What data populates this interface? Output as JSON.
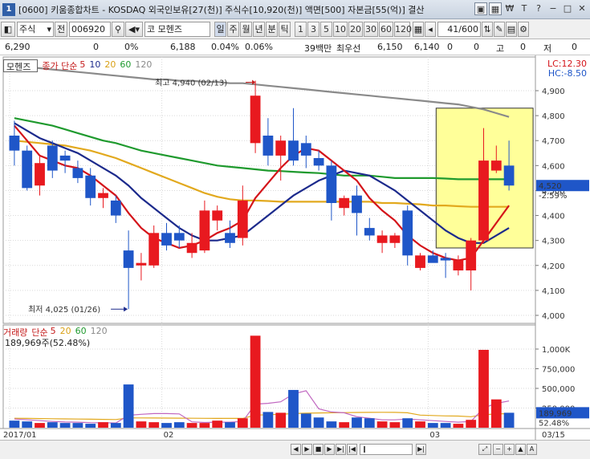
{
  "window": {
    "app_number": "1",
    "title": "[0600] 키움종합차트 - KOSDAQ 외국인보유[27(천)] 주식수[10,920(천)] 액면[500] 자본금[55(억)] 결산"
  },
  "toolbar": {
    "market": "주식",
    "prev": "전",
    "code": "006920",
    "stock_prefix": "코",
    "stock_name": "모헨즈",
    "periods": [
      "일",
      "주",
      "월",
      "년",
      "분",
      "틱"
    ],
    "intervals": [
      "1",
      "3",
      "5",
      "10",
      "20",
      "30",
      "60",
      "120"
    ],
    "page_counter": "41/600"
  },
  "infobar": {
    "price": "6,290",
    "change": "0",
    "pct": "0%",
    "open": "6,188",
    "r1": "0.04%",
    "r2": "0.06%",
    "amount": "39백만",
    "best_label": "최우선",
    "ask": "6,150",
    "bid": "6,140",
    "v1": "0",
    "v2": "0",
    "v3": "고",
    "v4": "0",
    "v5": "저",
    "v6": "0"
  },
  "price_legend": {
    "name": "모헨즈",
    "type": "종가 단순",
    "ma": [
      "5",
      "10",
      "20",
      "60",
      "120"
    ],
    "lc": "LC:12.30",
    "hc": "HC:-8.50"
  },
  "volume_legend": {
    "name": "거래량",
    "type": "단순",
    "ma": [
      "5",
      "20",
      "60",
      "120"
    ],
    "info": "189,969주(52.48%)"
  },
  "annotations": {
    "high": "최고 4,940 (02/13)",
    "low": "최저 4,025 (01/26)"
  },
  "current": {
    "price_label": "4,520",
    "pct_label": "-2.59%",
    "vol_label": "189,969",
    "vol_pct_label": "52.48%"
  },
  "colors": {
    "up": "#e8191f",
    "down": "#1f56c8",
    "ma5": "#d4141a",
    "ma10": "#1c2a8c",
    "ma20": "#e2a91e",
    "ma60": "#1f9a2e",
    "ma120": "#8a8a8a",
    "highlight": "#ffff99"
  },
  "chart_data": [
    {
      "type": "candlestick",
      "title": "모헨즈",
      "y_ticks": [
        4000,
        4100,
        4200,
        4300,
        4400,
        4500,
        4600,
        4700,
        4800,
        4900
      ],
      "ylim": [
        3970,
        5030
      ],
      "x_labels": [
        "2017/01",
        "02",
        "03",
        "03/15"
      ],
      "candles": [
        {
          "o": 4720,
          "h": 4780,
          "l": 4600,
          "c": 4660
        },
        {
          "o": 4660,
          "h": 4680,
          "l": 4500,
          "c": 4510
        },
        {
          "o": 4520,
          "h": 4640,
          "l": 4480,
          "c": 4610
        },
        {
          "o": 4680,
          "h": 4700,
          "l": 4550,
          "c": 4580
        },
        {
          "o": 4640,
          "h": 4660,
          "l": 4570,
          "c": 4620
        },
        {
          "o": 4590,
          "h": 4620,
          "l": 4530,
          "c": 4550
        },
        {
          "o": 4560,
          "h": 4590,
          "l": 4440,
          "c": 4470
        },
        {
          "o": 4470,
          "h": 4510,
          "l": 4430,
          "c": 4490
        },
        {
          "o": 4460,
          "h": 4480,
          "l": 4370,
          "c": 4400
        },
        {
          "o": 4260,
          "h": 4340,
          "l": 4025,
          "c": 4190
        },
        {
          "o": 4200,
          "h": 4250,
          "l": 4140,
          "c": 4210
        },
        {
          "o": 4200,
          "h": 4360,
          "l": 4190,
          "c": 4330
        },
        {
          "o": 4330,
          "h": 4370,
          "l": 4260,
          "c": 4280
        },
        {
          "o": 4330,
          "h": 4360,
          "l": 4270,
          "c": 4300
        },
        {
          "o": 4250,
          "h": 4330,
          "l": 4230,
          "c": 4290
        },
        {
          "o": 4260,
          "h": 4460,
          "l": 4250,
          "c": 4420
        },
        {
          "o": 4380,
          "h": 4440,
          "l": 4340,
          "c": 4420
        },
        {
          "o": 4330,
          "h": 4380,
          "l": 4270,
          "c": 4290
        },
        {
          "o": 4310,
          "h": 4520,
          "l": 4280,
          "c": 4460
        },
        {
          "o": 4690,
          "h": 4940,
          "l": 4650,
          "c": 4880
        },
        {
          "o": 4720,
          "h": 4790,
          "l": 4600,
          "c": 4640
        },
        {
          "o": 4640,
          "h": 4720,
          "l": 4540,
          "c": 4700
        },
        {
          "o": 4700,
          "h": 4830,
          "l": 4600,
          "c": 4620
        },
        {
          "o": 4690,
          "h": 4720,
          "l": 4590,
          "c": 4640
        },
        {
          "o": 4630,
          "h": 4660,
          "l": 4580,
          "c": 4600
        },
        {
          "o": 4600,
          "h": 4620,
          "l": 4380,
          "c": 4450
        },
        {
          "o": 4430,
          "h": 4480,
          "l": 4400,
          "c": 4470
        },
        {
          "o": 4480,
          "h": 4520,
          "l": 4320,
          "c": 4410
        },
        {
          "o": 4350,
          "h": 4390,
          "l": 4300,
          "c": 4320
        },
        {
          "o": 4290,
          "h": 4340,
          "l": 4250,
          "c": 4320
        },
        {
          "o": 4290,
          "h": 4330,
          "l": 4270,
          "c": 4320
        },
        {
          "o": 4420,
          "h": 4440,
          "l": 4200,
          "c": 4240
        },
        {
          "o": 4190,
          "h": 4250,
          "l": 4180,
          "c": 4240
        },
        {
          "o": 4240,
          "h": 4260,
          "l": 4220,
          "c": 4210
        },
        {
          "o": 4230,
          "h": 4250,
          "l": 4150,
          "c": 4220
        },
        {
          "o": 4180,
          "h": 4240,
          "l": 4160,
          "c": 4220
        },
        {
          "o": 4180,
          "h": 4310,
          "l": 4100,
          "c": 4300
        },
        {
          "o": 4300,
          "h": 4750,
          "l": 4290,
          "c": 4620
        },
        {
          "o": 4580,
          "h": 4680,
          "l": 4570,
          "c": 4620
        },
        {
          "o": 4600,
          "h": 4700,
          "l": 4500,
          "c": 4520
        }
      ],
      "moving_averages": [
        {
          "name": "5",
          "values": [
            4760,
            4700,
            4640,
            4620,
            4600,
            4590,
            4560,
            4520,
            4480,
            4410,
            4350,
            4310,
            4290,
            4270,
            4280,
            4300,
            4330,
            4350,
            4380,
            4470,
            4530,
            4590,
            4640,
            4670,
            4660,
            4620,
            4580,
            4540,
            4470,
            4420,
            4380,
            4320,
            4280,
            4250,
            4230,
            4220,
            4230,
            4300,
            4370,
            4440
          ]
        },
        {
          "name": "10",
          "values": [
            4770,
            4740,
            4710,
            4690,
            4670,
            4650,
            4620,
            4590,
            4560,
            4520,
            4470,
            4430,
            4390,
            4350,
            4320,
            4300,
            4300,
            4310,
            4320,
            4360,
            4400,
            4440,
            4480,
            4510,
            4540,
            4560,
            4580,
            4570,
            4560,
            4530,
            4500,
            4460,
            4420,
            4380,
            4340,
            4310,
            4290,
            4290,
            4320,
            4350
          ]
        },
        {
          "name": "20",
          "values": [
            4700,
            4695,
            4690,
            4685,
            4680,
            4670,
            4660,
            4645,
            4630,
            4610,
            4590,
            4570,
            4550,
            4530,
            4510,
            4490,
            4475,
            4465,
            4460,
            4460,
            4458,
            4455,
            4455,
            4455,
            4455,
            4455,
            4455,
            4455,
            4455,
            4450,
            4450,
            4447,
            4445,
            4440,
            4440,
            4437,
            4435,
            4435,
            4435,
            4435
          ]
        },
        {
          "name": "60",
          "values": [
            4790,
            4780,
            4770,
            4760,
            4745,
            4730,
            4715,
            4700,
            4690,
            4675,
            4660,
            4650,
            4640,
            4630,
            4620,
            4610,
            4600,
            4595,
            4590,
            4585,
            4580,
            4578,
            4575,
            4572,
            4570,
            4565,
            4560,
            4560,
            4560,
            4555,
            4550,
            4550,
            4550,
            4550,
            4548,
            4545,
            4545,
            4545,
            4545,
            4545
          ]
        },
        {
          "name": "120",
          "values": [
            5000,
            4995,
            4990,
            4985,
            4980,
            4975,
            4970,
            4965,
            4960,
            4955,
            4950,
            4945,
            4945,
            4940,
            4940,
            4935,
            4935,
            4930,
            4930,
            4925,
            4920,
            4915,
            4910,
            4905,
            4900,
            4895,
            4890,
            4885,
            4880,
            4875,
            4870,
            4865,
            4860,
            4855,
            4850,
            4845,
            4835,
            4825,
            4810,
            4795
          ]
        }
      ],
      "annotations": [
        "최고 4,940 (02/13)",
        "최저 4,025 (01/26)"
      ],
      "current_price": 4520,
      "grid": true
    },
    {
      "type": "bar",
      "title": "거래량",
      "y_ticks": [
        250000,
        500000,
        750000,
        1000000
      ],
      "y_tick_labels": [
        "250,000",
        "500,000",
        "750,000",
        "1,000K"
      ],
      "ylim": [
        0,
        1150000
      ],
      "volumes": [
        90000,
        80000,
        60000,
        70000,
        60000,
        60000,
        50000,
        70000,
        60000,
        550000,
        80000,
        70000,
        60000,
        70000,
        60000,
        60000,
        90000,
        70000,
        120000,
        1170000,
        200000,
        190000,
        480000,
        180000,
        130000,
        80000,
        70000,
        130000,
        120000,
        80000,
        70000,
        120000,
        80000,
        60000,
        60000,
        50000,
        100000,
        990000,
        360000,
        190000
      ],
      "volume_ma5": [
        110000,
        100000,
        90000,
        80000,
        72000,
        70000,
        64000,
        62000,
        60000,
        158000,
        170000,
        180000,
        180000,
        176000,
        74000,
        66000,
        70000,
        70000,
        80000,
        300000,
        310000,
        330000,
        430000,
        470000,
        240000,
        200000,
        190000,
        140000,
        120000,
        100000,
        100000,
        110000,
        100000,
        90000,
        80000,
        70000,
        80000,
        250000,
        310000,
        340000
      ],
      "volume_ma20": [
        120000,
        118000,
        116000,
        114000,
        112000,
        110000,
        108000,
        106000,
        104000,
        125000,
        124000,
        123000,
        122000,
        121000,
        120000,
        119000,
        118000,
        118000,
        118000,
        160000,
        165000,
        170000,
        180000,
        185000,
        188000,
        190000,
        192000,
        194000,
        195000,
        196000,
        195000,
        190000,
        160000,
        155000,
        150000,
        148000,
        140000,
        165000,
        175000,
        180000
      ],
      "current_volume": 189969,
      "grid": true
    }
  ]
}
